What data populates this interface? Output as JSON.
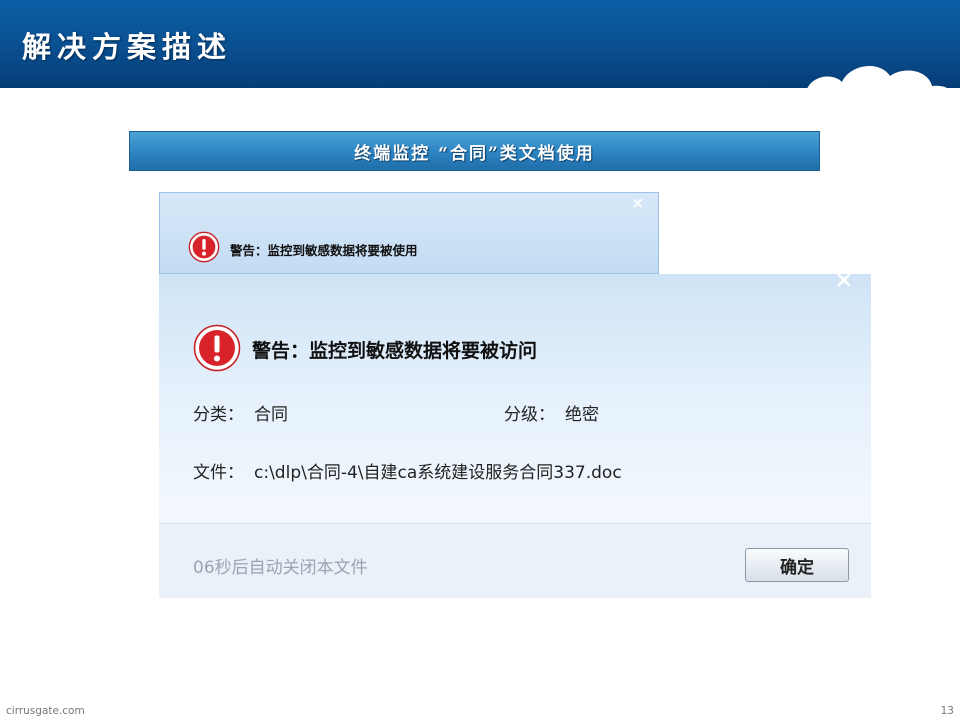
{
  "slide": {
    "title": "解决方案描述",
    "banner": "终端监控 “合同”类文档使用",
    "site": "cirrusgate.com",
    "page_number": "13"
  },
  "dialog_back": {
    "close_glyph": "×",
    "icon": "warning-icon",
    "title": "警告：监控到敏感数据将要被使用"
  },
  "dialog_front": {
    "close_glyph": "×",
    "icon": "warning-icon",
    "title": "警告：监控到敏感数据将要被访问",
    "category_label": "分类：",
    "category_value": "合同",
    "level_label": "分级：",
    "level_value": "绝密",
    "file_label": "文件：",
    "file_value": "c:\\dlp\\合同-4\\自建ca系统建设服务合同337.doc",
    "countdown": "06秒后自动关闭本文件",
    "ok_label": "确定"
  },
  "colors": {
    "header_blue": "#0a4f90",
    "banner_blue": "#2e86c4",
    "warning_red": "#d8232a"
  }
}
